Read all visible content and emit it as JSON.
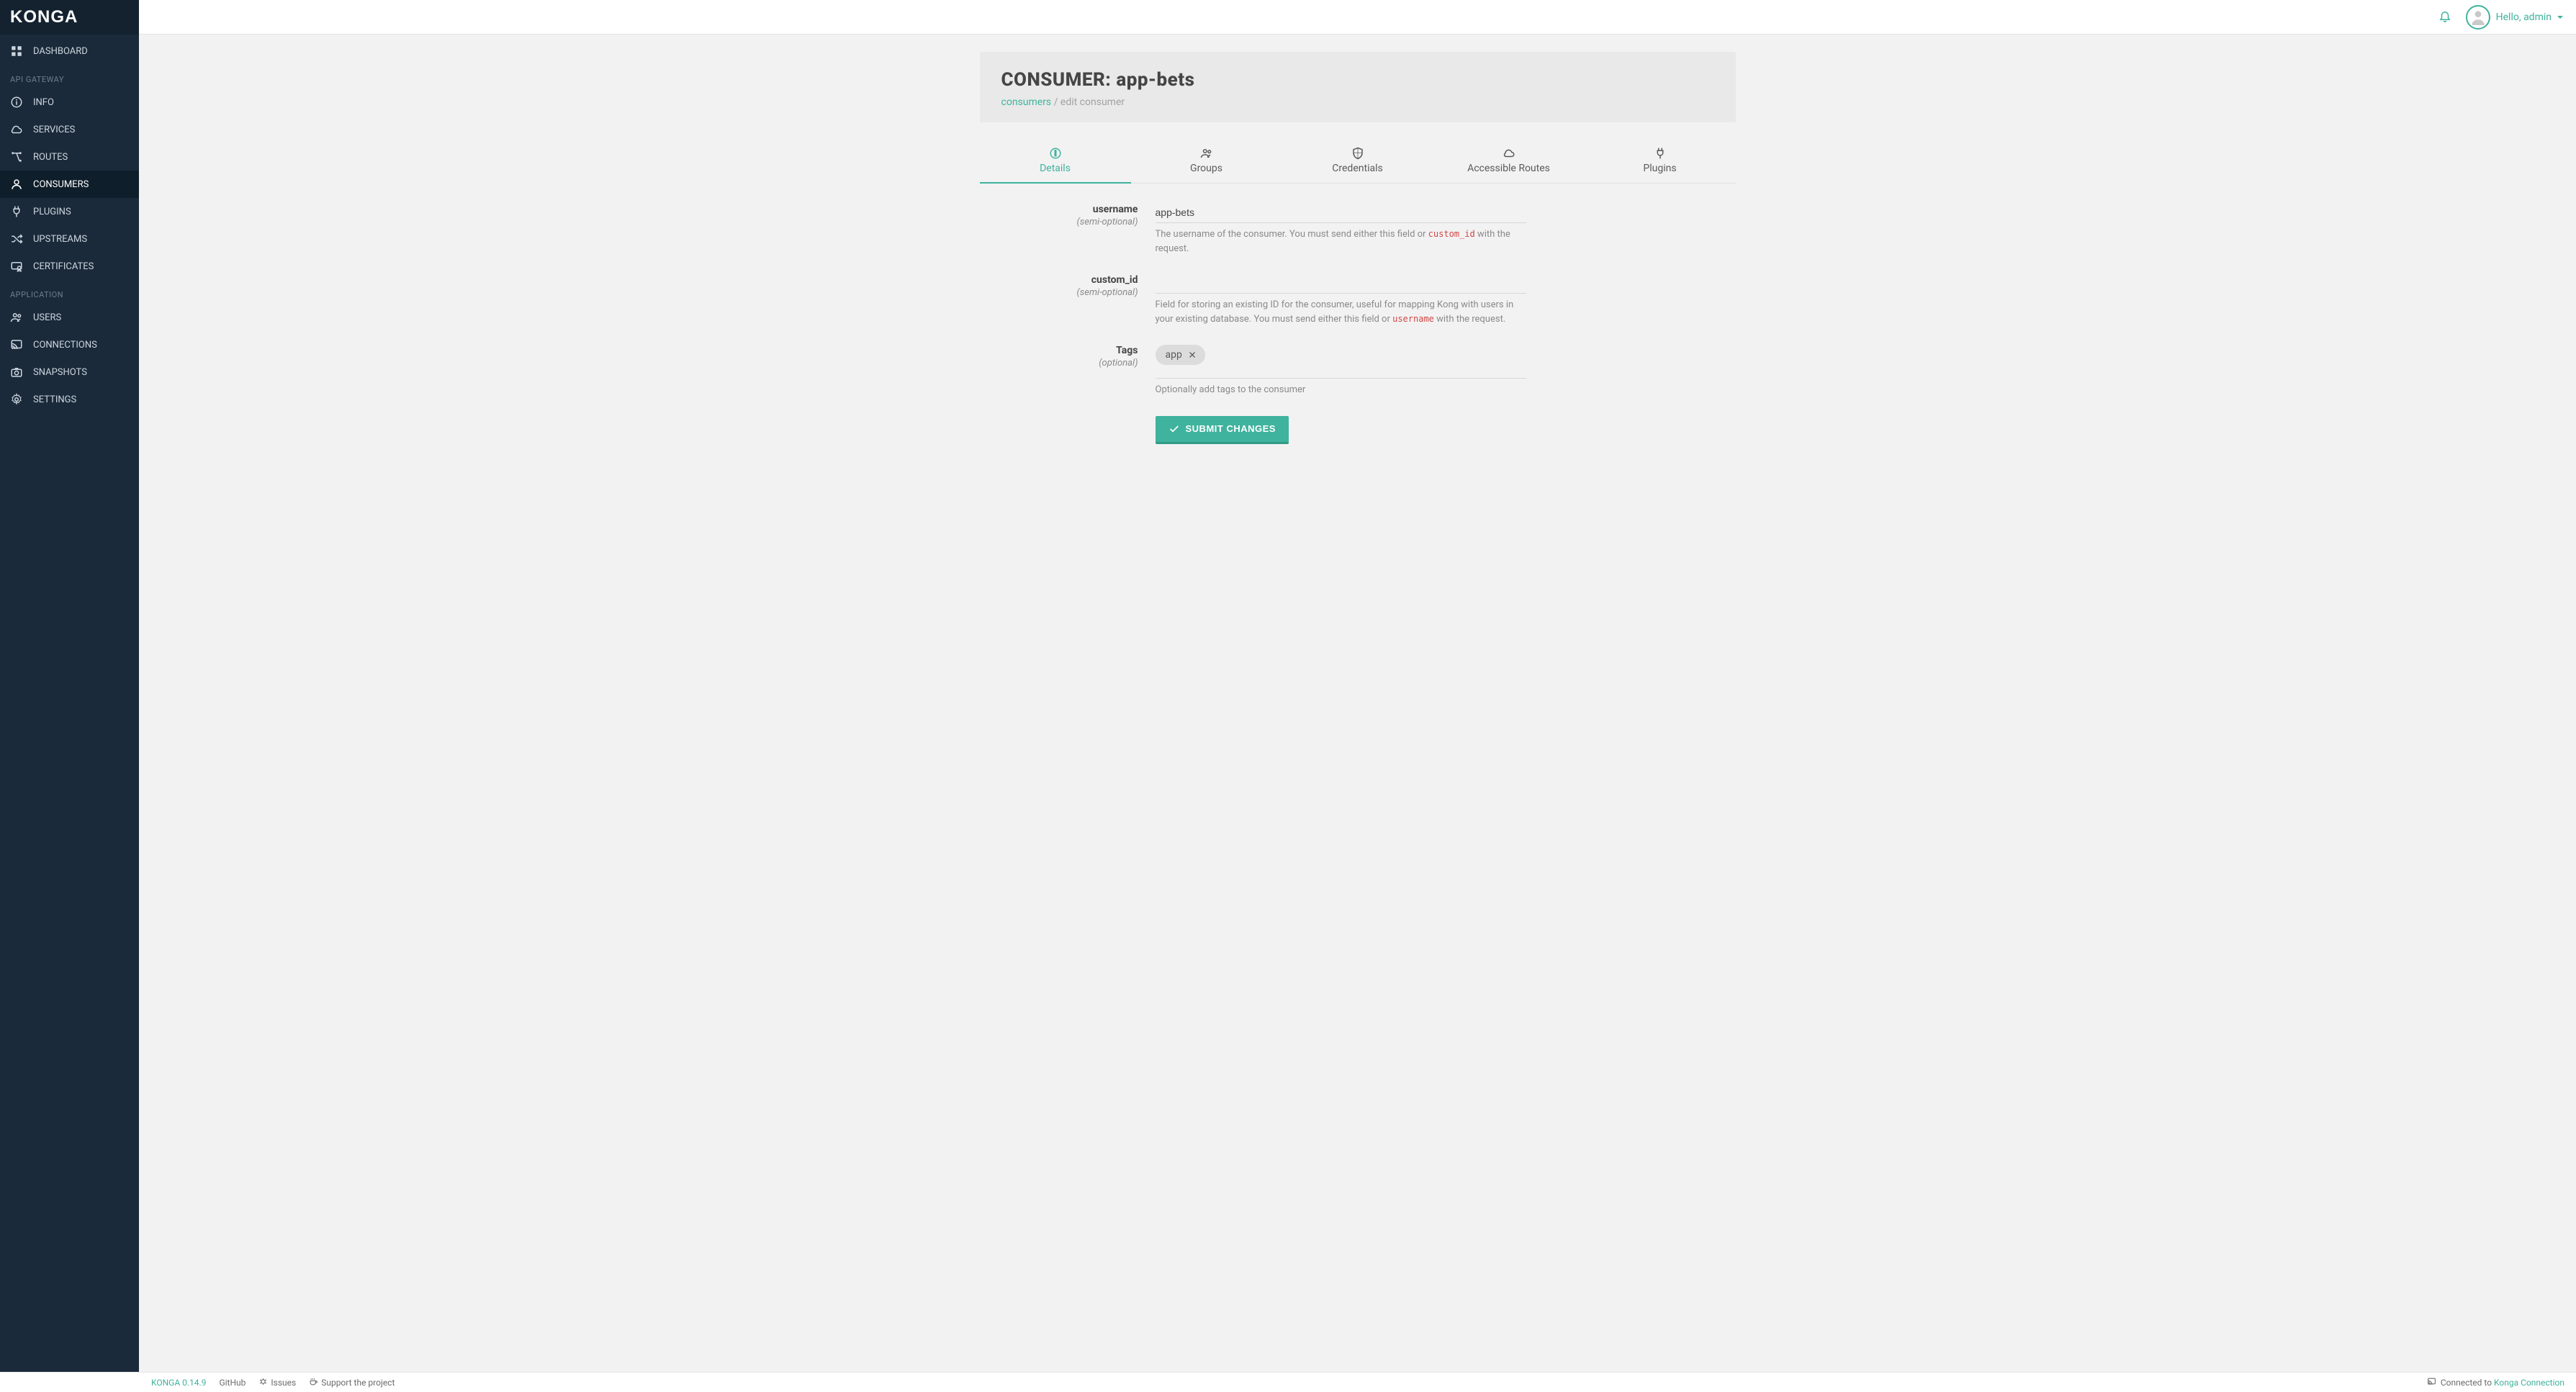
{
  "brand": "KONGA",
  "topbar": {
    "greeting_prefix": "Hello, ",
    "user": "admin"
  },
  "sidebar": {
    "items_top": [
      {
        "id": "dashboard",
        "label": "DASHBOARD",
        "icon": "dashboard"
      }
    ],
    "section_gateway": "API GATEWAY",
    "items_gateway": [
      {
        "id": "info",
        "label": "INFO",
        "icon": "info"
      },
      {
        "id": "services",
        "label": "SERVICES",
        "icon": "cloud"
      },
      {
        "id": "routes",
        "label": "ROUTES",
        "icon": "routes"
      },
      {
        "id": "consumers",
        "label": "CONSUMERS",
        "icon": "person",
        "active": true
      },
      {
        "id": "plugins",
        "label": "PLUGINS",
        "icon": "plug"
      },
      {
        "id": "upstreams",
        "label": "UPSTREAMS",
        "icon": "shuffle"
      },
      {
        "id": "certificates",
        "label": "CERTIFICATES",
        "icon": "cert"
      }
    ],
    "section_app": "APPLICATION",
    "items_app": [
      {
        "id": "users",
        "label": "USERS",
        "icon": "users"
      },
      {
        "id": "connections",
        "label": "CONNECTIONS",
        "icon": "cast"
      },
      {
        "id": "snapshots",
        "label": "SNAPSHOTS",
        "icon": "camera"
      },
      {
        "id": "settings",
        "label": "SETTINGS",
        "icon": "gear"
      }
    ]
  },
  "page": {
    "title_prefix": "CONSUMER: ",
    "title_name": "app-bets",
    "breadcrumb_link": "consumers",
    "breadcrumb_sep": " / ",
    "breadcrumb_current": "edit consumer"
  },
  "tabs": [
    {
      "id": "details",
      "label": "Details",
      "icon": "info",
      "active": true
    },
    {
      "id": "groups",
      "label": "Groups",
      "icon": "users"
    },
    {
      "id": "credentials",
      "label": "Credentials",
      "icon": "shield"
    },
    {
      "id": "routes",
      "label": "Accessible Routes",
      "icon": "cloud"
    },
    {
      "id": "plugins",
      "label": "Plugins",
      "icon": "plug"
    }
  ],
  "form": {
    "username": {
      "label": "username",
      "sub": "(semi-optional)",
      "value": "app-bets",
      "help_a": "The username of the consumer. You must send either this field or ",
      "help_code": "custom_id",
      "help_b": " with the request."
    },
    "custom_id": {
      "label": "custom_id",
      "sub": "(semi-optional)",
      "value": "",
      "help_a": "Field for storing an existing ID for the consumer, useful for mapping Kong with users in your existing database. You must send either this field or ",
      "help_code": "username",
      "help_b": " with the request."
    },
    "tags": {
      "label": "Tags",
      "sub": "(optional)",
      "items": [
        "app"
      ],
      "help": "Optionally add tags to the consumer"
    },
    "submit": "SUBMIT CHANGES"
  },
  "footer": {
    "version": "KONGA 0.14.9",
    "links": [
      {
        "label": "GitHub"
      },
      {
        "label": "Issues",
        "icon": "bug"
      },
      {
        "label": "Support the project",
        "icon": "coffee"
      }
    ],
    "conn_prefix": "Connected to ",
    "conn_name": "Konga Connection"
  }
}
